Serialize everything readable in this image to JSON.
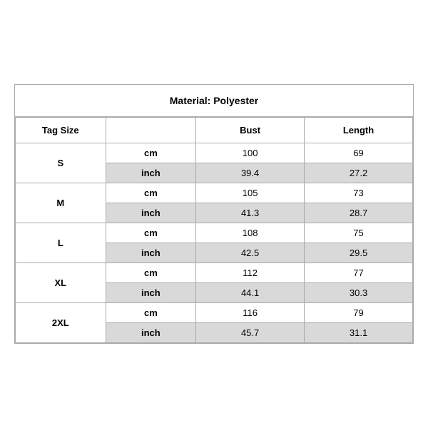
{
  "title": "Material: Polyester",
  "headers": {
    "tag_size": "Tag Size",
    "bust": "Bust",
    "length": "Length"
  },
  "sizes": [
    {
      "tag": "S",
      "cm": {
        "bust": "100",
        "length": "69"
      },
      "inch": {
        "bust": "39.4",
        "length": "27.2"
      }
    },
    {
      "tag": "M",
      "cm": {
        "bust": "105",
        "length": "73"
      },
      "inch": {
        "bust": "41.3",
        "length": "28.7"
      }
    },
    {
      "tag": "L",
      "cm": {
        "bust": "108",
        "length": "75"
      },
      "inch": {
        "bust": "42.5",
        "length": "29.5"
      }
    },
    {
      "tag": "XL",
      "cm": {
        "bust": "112",
        "length": "77"
      },
      "inch": {
        "bust": "44.1",
        "length": "30.3"
      }
    },
    {
      "tag": "2XL",
      "cm": {
        "bust": "116",
        "length": "79"
      },
      "inch": {
        "bust": "45.7",
        "length": "31.1"
      }
    }
  ],
  "unit_cm": "cm",
  "unit_inch": "inch"
}
